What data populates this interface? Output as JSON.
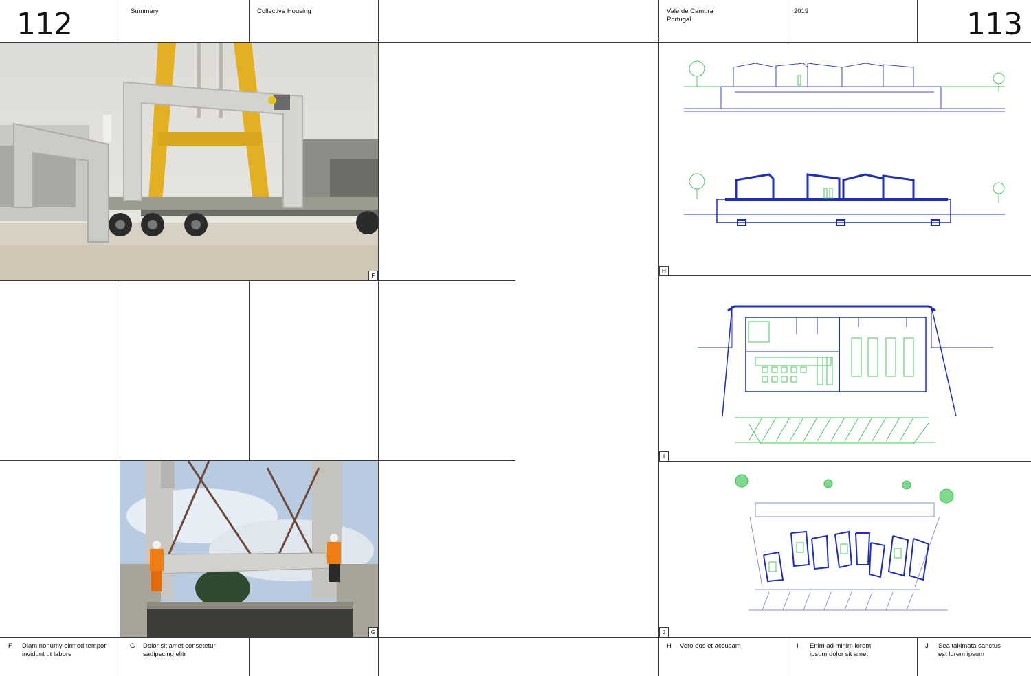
{
  "left_page": {
    "number": "112",
    "header": {
      "section": "Summary",
      "category": "Collective Housing"
    },
    "figures": [
      {
        "label": "F",
        "caption": "Diam nonumy eirmod tempor\ninvidunt ut labore",
        "description": "photo of precast concrete frame being lifted onto a truck by a yellow crane"
      },
      {
        "label": "G",
        "caption": "Dolor sit amet consetetur\nsadipscing elitr",
        "description": "photo of workers in orange vests guiding a concrete slab"
      }
    ]
  },
  "right_page": {
    "number": "113",
    "header": {
      "location": "Vale de Cambra\nPortugal",
      "year": "2019"
    },
    "figures": [
      {
        "label": "H",
        "caption": "Vero eos et accusam",
        "description": "elevation and section drawings"
      },
      {
        "label": "I",
        "caption": "Enim ad minim lorem\nipsum dolor sit amet",
        "description": "floor plan drawing"
      },
      {
        "label": "J",
        "caption": "Sea takimata sanctus\nest lorem ipsum",
        "description": "site plan drawing"
      }
    ]
  },
  "colors": {
    "drawing_blue": "#1f2fb5",
    "drawing_green": "#3fbf5a",
    "crane_yellow": "#e6b422",
    "rule": "#3a3a3a"
  }
}
